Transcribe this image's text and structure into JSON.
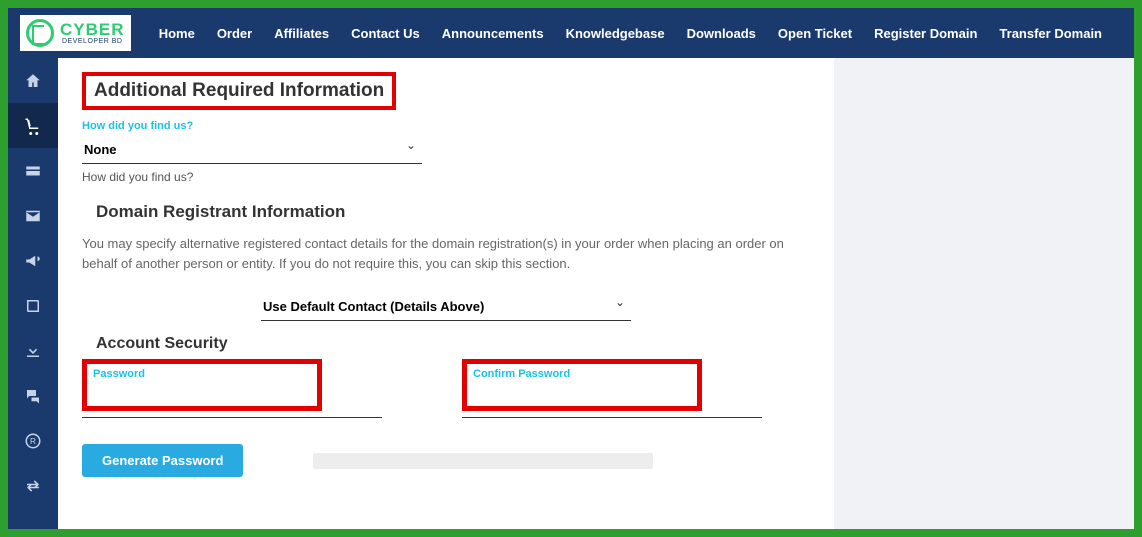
{
  "logo": {
    "brand": "CYBER",
    "sub": "DEVELOPER BD"
  },
  "nav": {
    "home": "Home",
    "order": "Order",
    "affiliates": "Affiliates",
    "contact": "Contact Us",
    "announcements": "Announcements",
    "knowledgebase": "Knowledgebase",
    "downloads": "Downloads",
    "openticket": "Open Ticket",
    "registerdomain": "Register Domain",
    "transferdomain": "Transfer Domain"
  },
  "section": {
    "title": "Additional Required Information",
    "howfind_label": "How did you find us?",
    "howfind_value": "None",
    "howfind_helper": "How did you find us?"
  },
  "registrant": {
    "title": "Domain Registrant Information",
    "desc": "You may specify alternative registered contact details for the domain registration(s) in your order when placing an order on behalf of another person or entity. If you do not require this, you can skip this section.",
    "contact_select": "Use Default Contact (Details Above)"
  },
  "security": {
    "title": "Account Security",
    "password_label": "Password",
    "confirm_label": "Confirm Password",
    "generate_btn": "Generate Password"
  }
}
